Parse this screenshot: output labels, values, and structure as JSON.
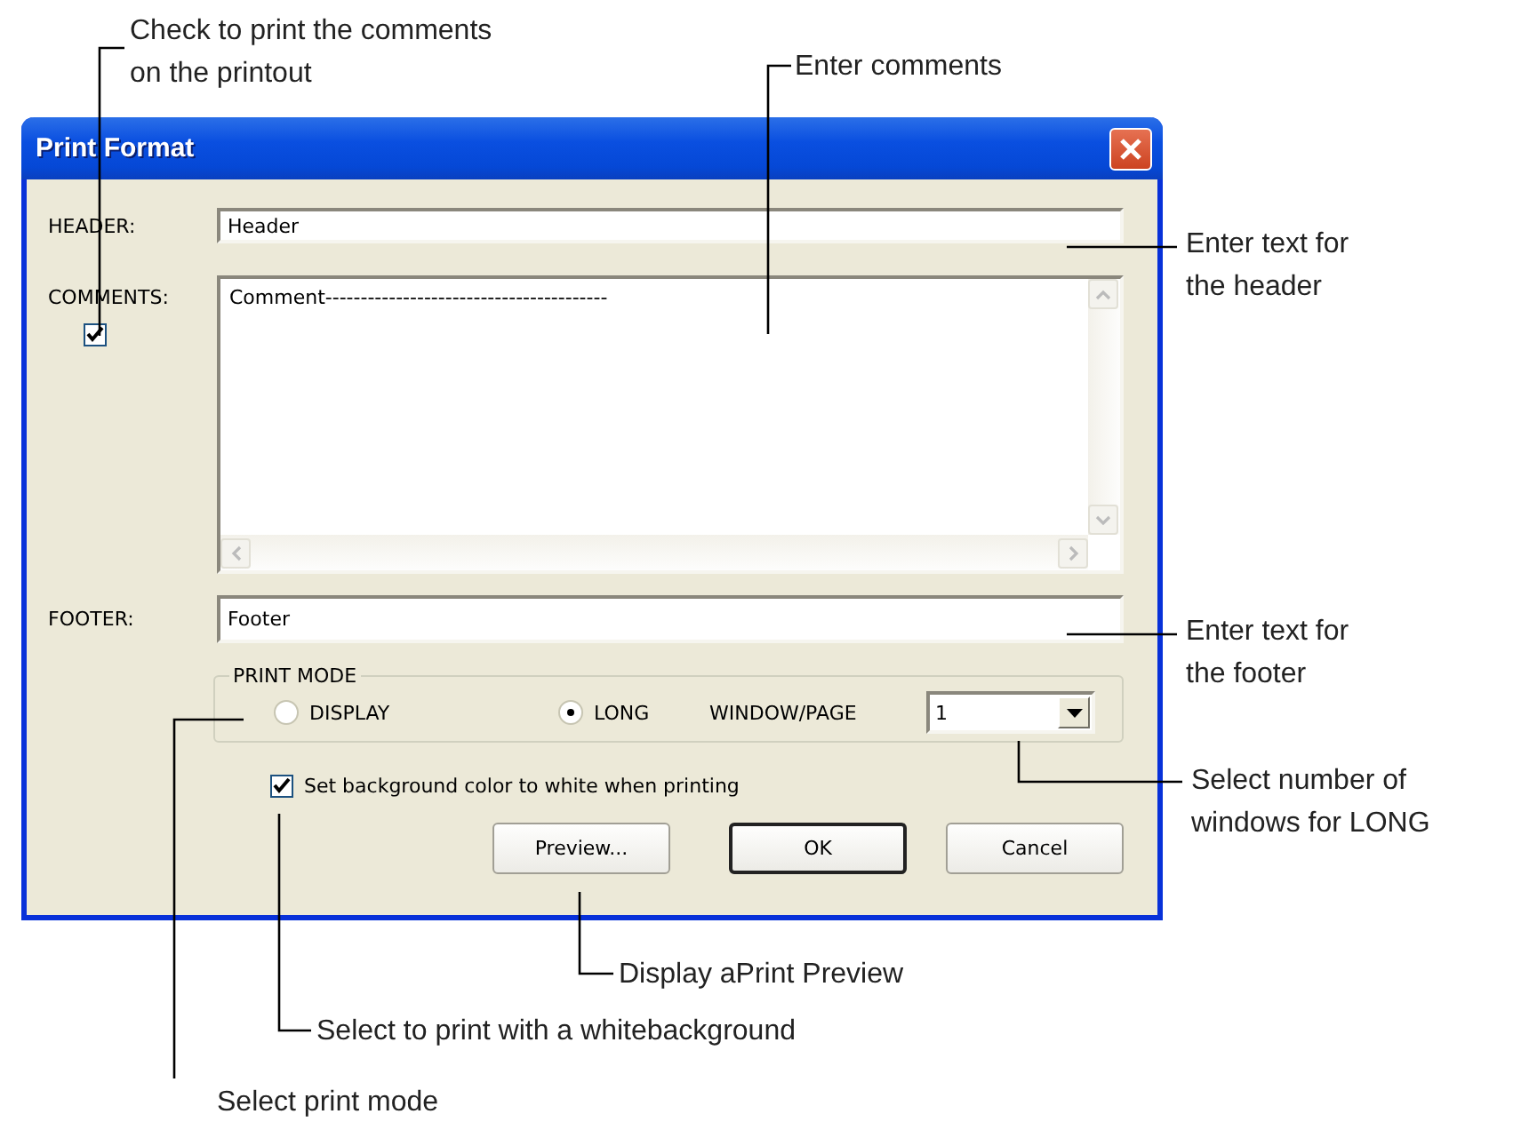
{
  "window": {
    "title": "Print Format"
  },
  "header": {
    "label": "HEADER:",
    "value": "Header"
  },
  "comments": {
    "label": "COMMENTS:",
    "checked": true,
    "value": "Comment----------------------------------------"
  },
  "footer": {
    "label": "FOOTER:",
    "value": "Footer"
  },
  "print_mode": {
    "title": "PRINT MODE",
    "options": [
      {
        "label": "DISPLAY",
        "selected": false
      },
      {
        "label": "LONG",
        "selected": true
      }
    ],
    "window_page_label": "WINDOW/PAGE",
    "window_page_value": "1"
  },
  "white_background": {
    "label": "Set background color to white when printing",
    "checked": true
  },
  "buttons": [
    {
      "label": "Preview...",
      "default": false
    },
    {
      "label": "OK",
      "default": true
    },
    {
      "label": "Cancel",
      "default": false
    }
  ],
  "callouts": [
    {
      "text": "Check to print the comments\non the printout"
    },
    {
      "text": "Enter comments"
    },
    {
      "text": "Enter text for\nthe header"
    },
    {
      "text": "Enter text for\nthe footer"
    },
    {
      "text": "Select number of\nwindows for LONG"
    },
    {
      "text": "Display aPrint Preview"
    },
    {
      "text": "Select to print with a whitebackground"
    },
    {
      "text": "Select print mode"
    }
  ]
}
